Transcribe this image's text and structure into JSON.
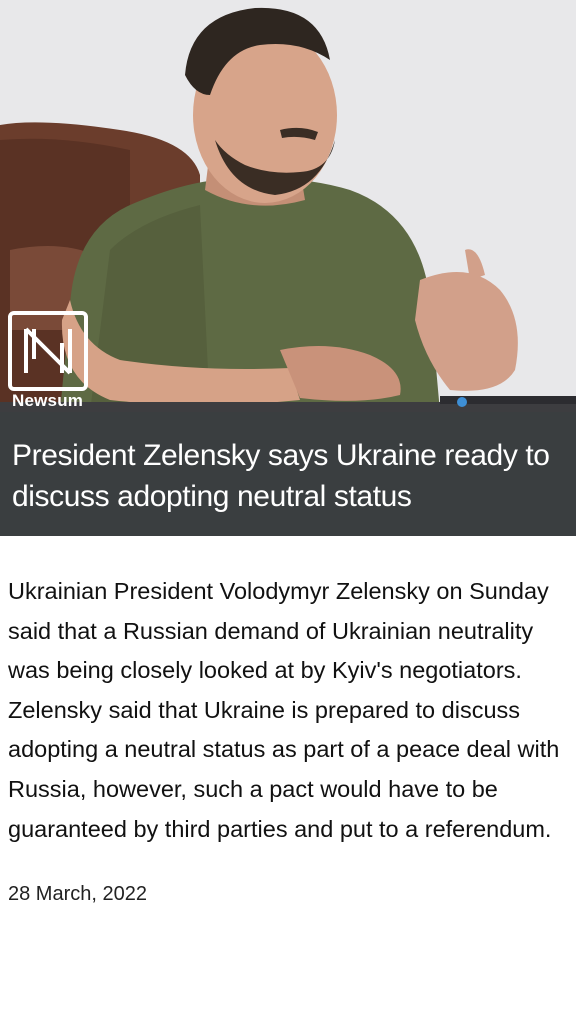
{
  "image": {
    "description_icon": "person-photo",
    "brand": "Newsum"
  },
  "article": {
    "headline": "President Zelensky says Ukraine ready to discuss adopting neutral status",
    "paragraph1": "Ukrainian President Volodymyr Zelensky on Sunday said that a Russian demand of Ukrainian neutrality was being closely looked at by Kyiv's negotiators.",
    "paragraph2": "Zelensky said that Ukraine is prepared to discuss adopting a neutral status as part of a peace deal with Russia, however, such a pact would have to be guaranteed by third parties and put to a referendum.",
    "date": "28 March, 2022"
  },
  "colors": {
    "headline_band": "#3a3e40",
    "shirt": "#5e6a44"
  }
}
